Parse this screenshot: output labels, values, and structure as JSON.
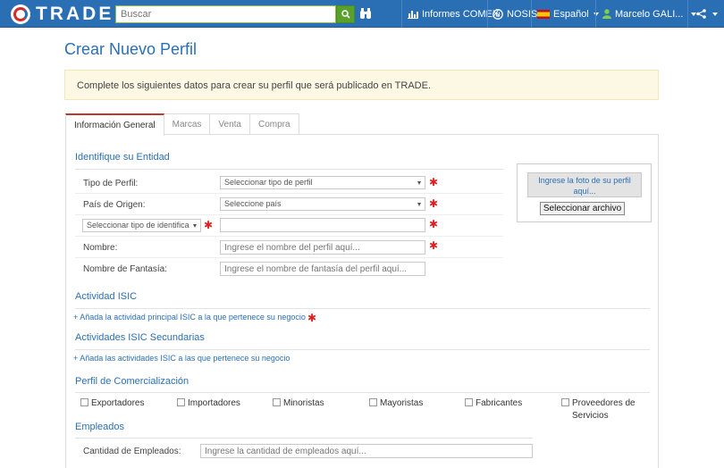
{
  "header": {
    "logo_text": "TRADE",
    "search_placeholder": "Buscar",
    "nav": {
      "informes": "Informes COMEX",
      "nosis": "NOSIS",
      "language": "Español",
      "user": "Marcelo GALI..."
    }
  },
  "page": {
    "title": "Crear Nuevo Perfil",
    "alert": "Complete los siguientes datos para crear su perfil que será publicado en TRADE."
  },
  "tabs": [
    {
      "label": "Información General"
    },
    {
      "label": "Marcas"
    },
    {
      "label": "Venta"
    },
    {
      "label": "Compra"
    }
  ],
  "entity": {
    "title": "Identifique su Entidad",
    "tipo_label": "Tipo de Perfil:",
    "tipo_value": "Seleccionar tipo de perfil",
    "pais_label": "País de Origen:",
    "pais_value": "Seleccione país",
    "id_type_value": "Seleccionar tipo de identifica",
    "nombre_label": "Nombre:",
    "nombre_placeholder": "Ingrese el nombre del perfil aquí...",
    "fantasia_label": "Nombre de Fantasía:",
    "fantasia_placeholder": "Ingrese el nombre de fantasía del perfil aquí..."
  },
  "photo": {
    "button": "Ingrese la foto de su perfil aquí...",
    "file_button": "Seleccionar archivo"
  },
  "isic": {
    "title": "Actividad ISIC",
    "add_link": "+ Añada la actividad principal ISIC a la que pertenece su negocio"
  },
  "isic_secondary": {
    "title": "Actividades ISIC Secundarias",
    "add_link": "+ Añada las actividades ISIC a las que pertenece su negocio"
  },
  "commercial": {
    "title": "Perfil de Comercialización",
    "options": [
      "Exportadores",
      "Importadores",
      "Minoristas",
      "Mayoristas",
      "Fabricantes",
      "Proveedores de Servicios"
    ]
  },
  "employees": {
    "title": "Empleados",
    "label": "Cantidad de Empleados:",
    "placeholder": "Ingrese la cantidad de empleados aquí..."
  }
}
